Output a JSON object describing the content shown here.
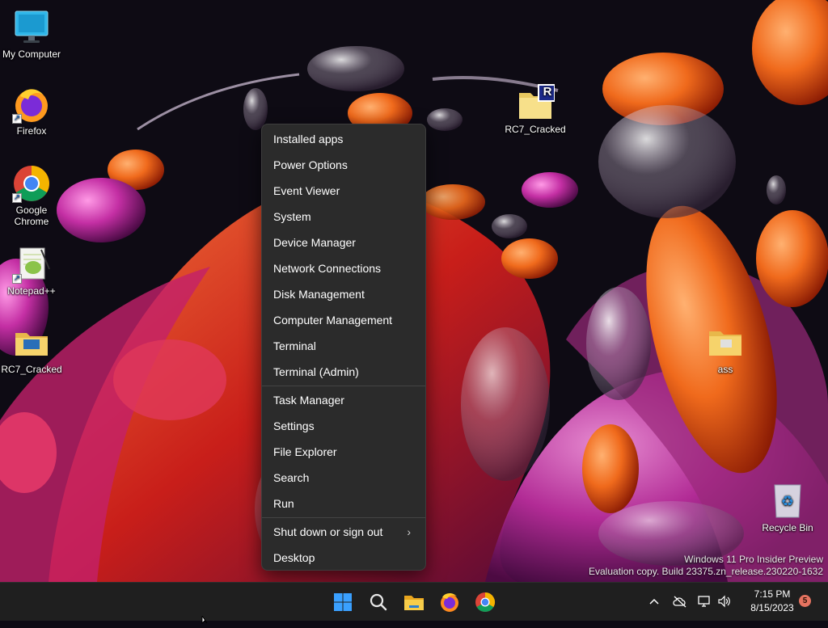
{
  "desktop": {
    "icons": [
      {
        "label": "My Computer",
        "icon": "monitor-icon"
      },
      {
        "label": "Firefox",
        "icon": "firefox-icon"
      },
      {
        "label": "Google Chrome",
        "icon": "chrome-icon"
      },
      {
        "label": "Notepad++",
        "icon": "notepad-plus-plus-icon"
      },
      {
        "label": "RC7_Cracked",
        "icon": "folder-icon"
      },
      {
        "label": "RC7_Cracked",
        "icon": "rar-archive-icon"
      },
      {
        "label": "ass",
        "icon": "folder-icon"
      },
      {
        "label": "Recycle Bin",
        "icon": "recycle-bin-icon"
      }
    ],
    "watermark": {
      "line1": "Windows 11 Pro Insider Preview",
      "line2": "Evaluation copy. Build 23375.zn_release.230220-1632"
    }
  },
  "context_menu": {
    "group1": [
      "Installed apps",
      "Power Options",
      "Event Viewer",
      "System",
      "Device Manager",
      "Network Connections",
      "Disk Management",
      "Computer Management",
      "Terminal",
      "Terminal (Admin)"
    ],
    "group2": [
      "Task Manager",
      "Settings",
      "File Explorer",
      "Search",
      "Run"
    ],
    "group3": [
      "Shut down or sign out",
      "Desktop"
    ],
    "submenu_chevron": "›"
  },
  "taskbar": {
    "pinned": [
      "start-icon",
      "search-icon",
      "file-explorer-icon",
      "firefox-icon",
      "chrome-icon"
    ],
    "tray": {
      "chevron": "^",
      "time": "7:15 PM",
      "date": "8/15/2023",
      "notification_count": "5"
    }
  },
  "colors": {
    "menu_bg": "#2b2b2b",
    "taskbar_bg": "#1f1f1f",
    "accent_blue": "#3aa0ff",
    "badge": "#e57360"
  }
}
